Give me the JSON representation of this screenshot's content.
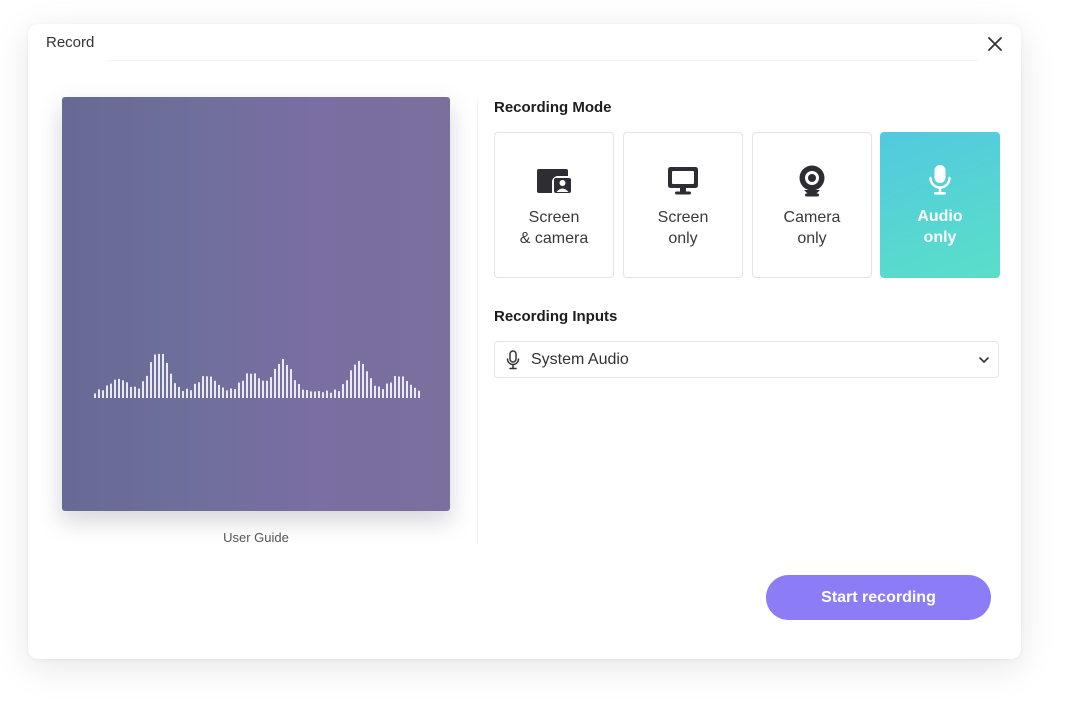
{
  "dialog": {
    "title": "Record",
    "close_icon": "close-icon"
  },
  "preview": {
    "caption": "User Guide",
    "waveform_icon": "audio-waveform"
  },
  "recording_mode": {
    "label": "Recording Mode",
    "selected": "Audio only",
    "options": [
      {
        "line1": "Screen",
        "line2": "& camera",
        "icon": "screen-camera-icon"
      },
      {
        "line1": "Screen",
        "line2": "only",
        "icon": "monitor-icon"
      },
      {
        "line1": "Camera",
        "line2": "only",
        "icon": "webcam-icon"
      },
      {
        "line1": "Audio",
        "line2": "only",
        "icon": "microphone-icon"
      }
    ]
  },
  "recording_inputs": {
    "label": "Recording Inputs",
    "selected_value": "System Audio",
    "icon": "microphone-icon"
  },
  "actions": {
    "start_label": "Start recording"
  },
  "colors": {
    "accent": "#8c7cf6",
    "active_mode_gradient_start": "#52c9df",
    "active_mode_gradient_end": "#5adfc8",
    "preview_bg": "#6f6f9c"
  }
}
